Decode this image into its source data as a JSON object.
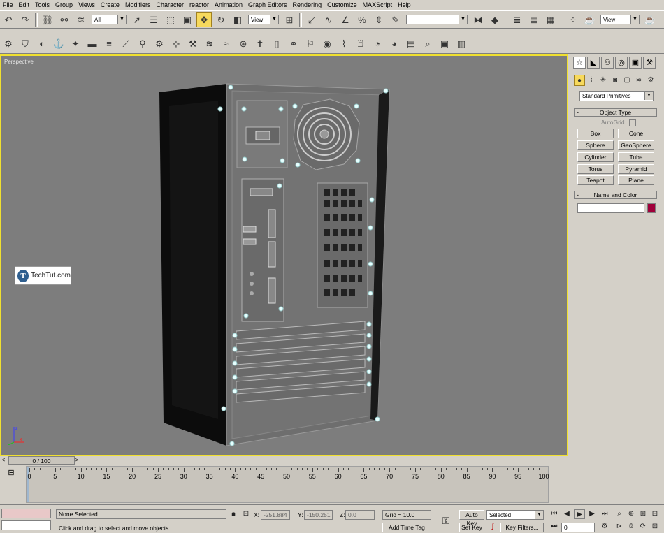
{
  "menu": [
    "File",
    "Edit",
    "Tools",
    "Group",
    "Views",
    "Create",
    "Modifiers",
    "Character",
    "reactor",
    "Animation",
    "Graph Editors",
    "Rendering",
    "Customize",
    "MAXScript",
    "Help"
  ],
  "toolbar1": {
    "selection_filter": "All",
    "ref_coord": "View",
    "named_selection": "",
    "render_view": "View"
  },
  "viewport": {
    "label": "Perspective",
    "watermark": "TechTut.com",
    "watermark_logo": "T",
    "axis_labels": {
      "z": "z",
      "x": "x"
    }
  },
  "command_panel": {
    "category": "Standard Primitives",
    "object_type_title": "Object Type",
    "autogrid_label": "AutoGrid",
    "buttons": [
      "Box",
      "Cone",
      "Sphere",
      "GeoSphere",
      "Cylinder",
      "Tube",
      "Torus",
      "Pyramid",
      "Teapot",
      "Plane"
    ],
    "name_color_title": "Name and Color",
    "name_value": "",
    "object_color": "#a0003a"
  },
  "timeline": {
    "slider": "0 / 100",
    "ticks": [
      "0",
      "5",
      "10",
      "15",
      "20",
      "25",
      "30",
      "35",
      "40",
      "45",
      "50",
      "55",
      "60",
      "65",
      "70",
      "75",
      "80",
      "85",
      "90",
      "95",
      "100"
    ]
  },
  "status": {
    "selection": "None Selected",
    "prompt": "Click and drag to select and move objects",
    "x_label": "X:",
    "x_value": "-251.884",
    "y_label": "Y:",
    "y_value": "-150.251",
    "z_label": "Z:",
    "z_value": "0.0",
    "grid": "Grid = 10.0",
    "add_time_tag": "Add Time Tag",
    "auto_key": "Auto Key",
    "set_key": "Set Key",
    "key_mode": "Selected",
    "key_filters": "Key Filters...",
    "frame": "0"
  },
  "colors": {
    "viewport_bg": "#7d7d7d",
    "viewport_border": "#f0e030",
    "ui_bg": "#d4d0c8",
    "active_tool": "#f7d95c"
  }
}
